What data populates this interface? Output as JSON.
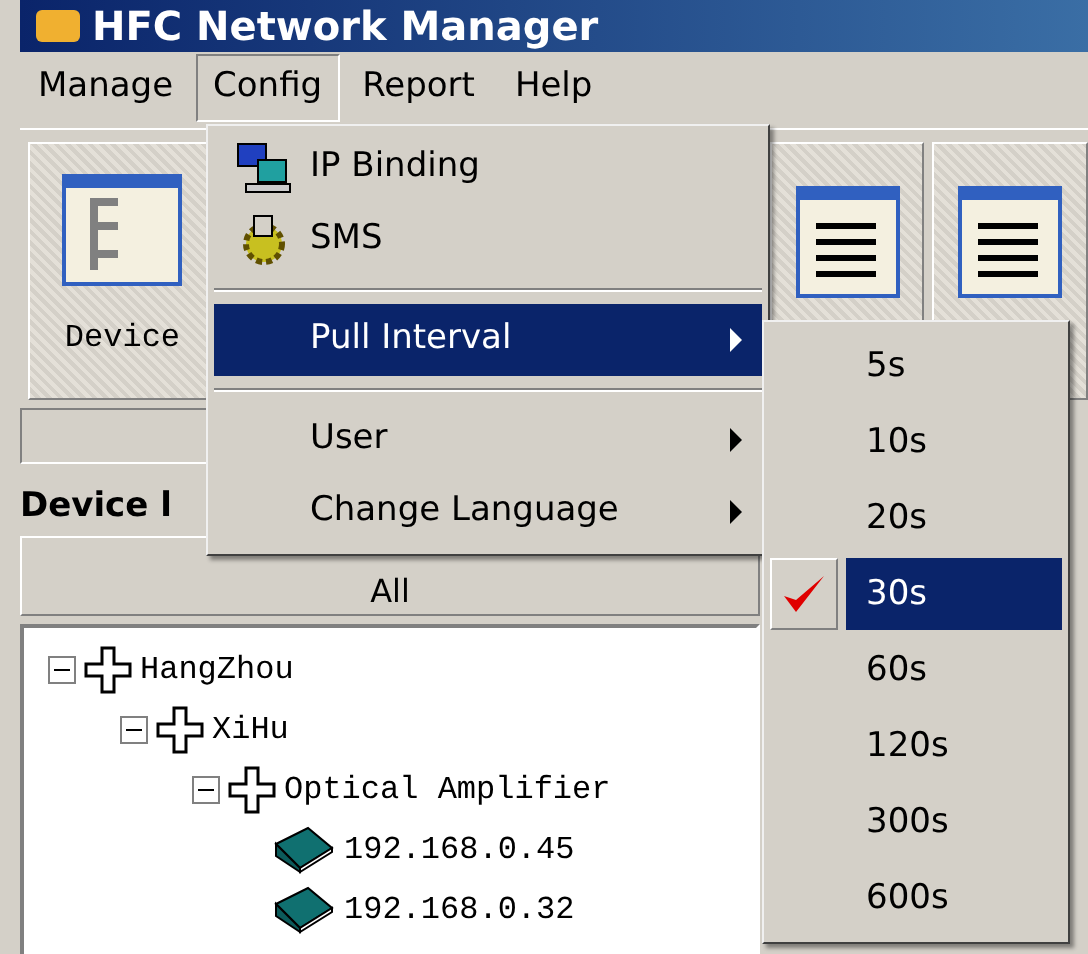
{
  "window": {
    "title": "HFC Network Manager"
  },
  "menubar": [
    {
      "label": "Manage",
      "selected": false
    },
    {
      "label": "Config",
      "selected": true
    },
    {
      "label": "Report",
      "selected": false
    },
    {
      "label": "Help",
      "selected": false
    }
  ],
  "toolbar": {
    "buttons": [
      {
        "label": "Device"
      }
    ]
  },
  "left_panel": {
    "title": "Device l",
    "filter": "All"
  },
  "tree": [
    {
      "label": "HangZhou",
      "kind": "group",
      "expanded": true,
      "children": [
        {
          "label": "XiHu",
          "kind": "group",
          "expanded": true,
          "children": [
            {
              "label": "Optical Amplifier",
              "kind": "group",
              "expanded": true,
              "children": [
                {
                  "label": "192.168.0.45",
                  "kind": "device"
                },
                {
                  "label": "192.168.0.32",
                  "kind": "device"
                }
              ]
            }
          ]
        }
      ]
    }
  ],
  "config_menu": {
    "items": [
      {
        "kind": "item",
        "label": "IP Binding",
        "selected": false
      },
      {
        "kind": "item",
        "label": "SMS",
        "selected": false
      },
      {
        "kind": "separator"
      },
      {
        "kind": "submenu",
        "label": "Pull Interval",
        "selected": true
      },
      {
        "kind": "separator"
      },
      {
        "kind": "submenu",
        "label": "User",
        "selected": false
      },
      {
        "kind": "submenu",
        "label": "Change Language",
        "selected": false
      }
    ]
  },
  "interval_menu": {
    "items": [
      {
        "label": "5s",
        "checked": false,
        "selected": false
      },
      {
        "label": "10s",
        "checked": false,
        "selected": false
      },
      {
        "label": "20s",
        "checked": false,
        "selected": false
      },
      {
        "label": "30s",
        "checked": true,
        "selected": true
      },
      {
        "label": "60s",
        "checked": false,
        "selected": false
      },
      {
        "label": "120s",
        "checked": false,
        "selected": false
      },
      {
        "label": "300s",
        "checked": false,
        "selected": false
      },
      {
        "label": "600s",
        "checked": false,
        "selected": false
      }
    ]
  }
}
